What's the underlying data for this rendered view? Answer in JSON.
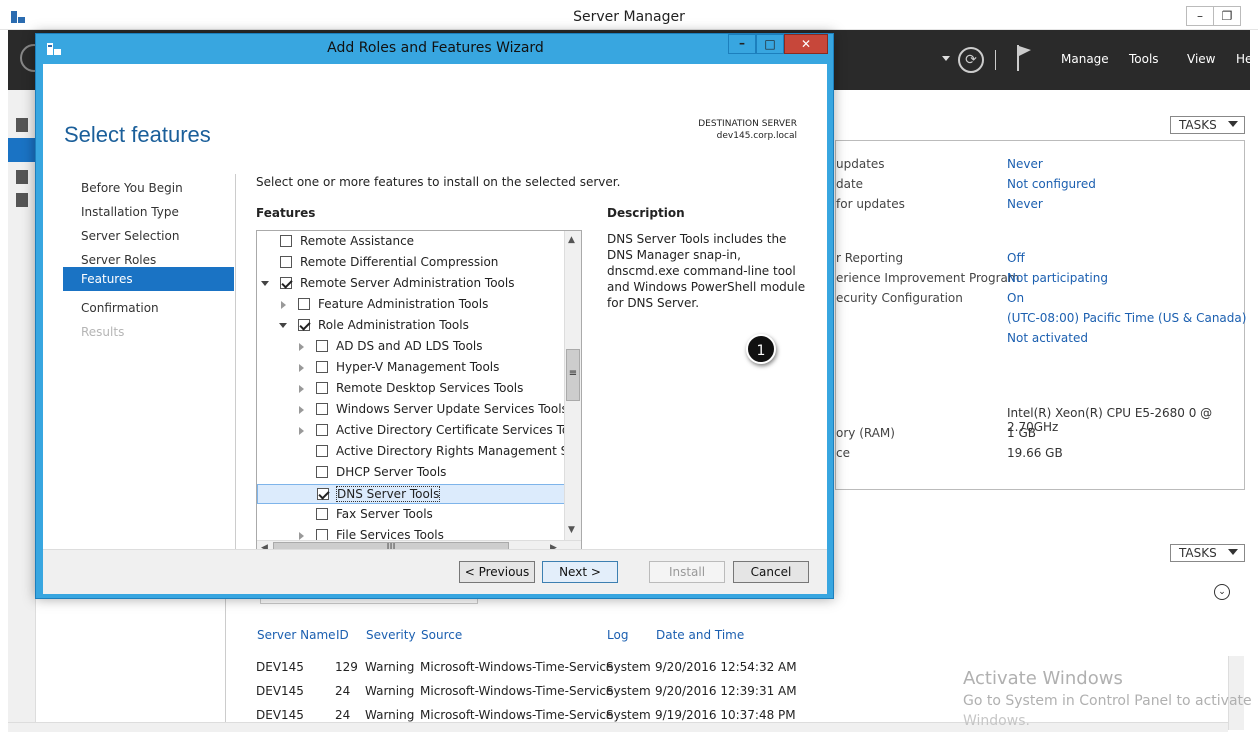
{
  "server_manager": {
    "title": "Server Manager",
    "nav": [
      "Manage",
      "Tools",
      "View",
      "He"
    ],
    "tasks_label": "TASKS",
    "properties": [
      {
        "label": "updates",
        "value": "Never",
        "link": true
      },
      {
        "label": "date",
        "value": "Not configured",
        "link": true
      },
      {
        "label": "for updates",
        "value": "Never",
        "link": true
      },
      {
        "label": "r Reporting",
        "value": "Off",
        "link": true
      },
      {
        "label": "erience Improvement Program",
        "value": "Not participating",
        "link": true
      },
      {
        "label": "ecurity Configuration",
        "value": "On",
        "link": true
      },
      {
        "label": "",
        "value": "(UTC-08:00) Pacific Time (US & Canada)",
        "link": true
      },
      {
        "label": "",
        "value": "Not activated",
        "link": true
      },
      {
        "label": "",
        "value": "Intel(R) Xeon(R) CPU E5-2680 0 @ 2.70GHz",
        "link": false
      },
      {
        "label": "ory (RAM)",
        "value": "1 GB",
        "link": false
      },
      {
        "label": "ce",
        "value": "19.66 GB",
        "link": false
      }
    ],
    "events": {
      "headers": [
        "Server Name",
        "ID",
        "Severity",
        "Source",
        "Log",
        "Date and Time"
      ],
      "rows": [
        [
          "DEV145",
          "129",
          "Warning",
          "Microsoft-Windows-Time-Service",
          "System",
          "9/20/2016 12:54:32 AM"
        ],
        [
          "DEV145",
          "24",
          "Warning",
          "Microsoft-Windows-Time-Service",
          "System",
          "9/20/2016 12:39:31 AM"
        ],
        [
          "DEV145",
          "24",
          "Warning",
          "Microsoft-Windows-Time-Service",
          "System",
          "9/19/2016 10:37:48 PM"
        ]
      ]
    },
    "watermark": {
      "line1": "Activate Windows",
      "line2": "Go to System in Control Panel to activate",
      "line3": "Windows."
    }
  },
  "wizard": {
    "title": "Add Roles and Features Wizard",
    "heading": "Select features",
    "destination_label": "DESTINATION SERVER",
    "destination_server": "dev145.corp.local",
    "nav": [
      {
        "label": "Before You Begin",
        "state": "normal"
      },
      {
        "label": "Installation Type",
        "state": "normal"
      },
      {
        "label": "Server Selection",
        "state": "normal"
      },
      {
        "label": "Server Roles",
        "state": "normal"
      },
      {
        "label": "Features",
        "state": "selected"
      },
      {
        "label": "Confirmation",
        "state": "normal"
      },
      {
        "label": "Results",
        "state": "disabled"
      }
    ],
    "instruction": "Select one or more features to install on the selected server.",
    "features_label": "Features",
    "description_label": "Description",
    "description": "DNS Server Tools includes the DNS Manager snap-in, dnscmd.exe command-line tool and Windows PowerShell module for DNS Server.",
    "tree": [
      {
        "label": "Remote Assistance",
        "level": 0,
        "checked": false,
        "exp": "none"
      },
      {
        "label": "Remote Differential Compression",
        "level": 0,
        "checked": false,
        "exp": "none"
      },
      {
        "label": "Remote Server Administration Tools",
        "level": 0,
        "checked": true,
        "exp": "collapse"
      },
      {
        "label": "Feature Administration Tools",
        "level": 1,
        "checked": false,
        "exp": "expand"
      },
      {
        "label": "Role Administration Tools",
        "level": 1,
        "checked": true,
        "exp": "collapse"
      },
      {
        "label": "AD DS and AD LDS Tools",
        "level": 2,
        "checked": false,
        "exp": "expand"
      },
      {
        "label": "Hyper-V Management Tools",
        "level": 2,
        "checked": false,
        "exp": "expand"
      },
      {
        "label": "Remote Desktop Services Tools",
        "level": 2,
        "checked": false,
        "exp": "expand"
      },
      {
        "label": "Windows Server Update Services Tools",
        "level": 2,
        "checked": false,
        "exp": "expand"
      },
      {
        "label": "Active Directory Certificate Services Tools",
        "level": 2,
        "checked": false,
        "exp": "expand"
      },
      {
        "label": "Active Directory Rights Management Servic",
        "level": 2,
        "checked": false,
        "exp": "none"
      },
      {
        "label": "DHCP Server Tools",
        "level": 2,
        "checked": false,
        "exp": "none"
      },
      {
        "label": "DNS Server Tools",
        "level": 2,
        "checked": true,
        "exp": "none",
        "selected": true
      },
      {
        "label": "Fax Server Tools",
        "level": 2,
        "checked": false,
        "exp": "none"
      },
      {
        "label": "File Services Tools",
        "level": 2,
        "checked": false,
        "exp": "expand"
      }
    ],
    "buttons": {
      "previous": "< Previous",
      "next": "Next >",
      "install": "Install",
      "cancel": "Cancel"
    }
  },
  "marker": "1"
}
